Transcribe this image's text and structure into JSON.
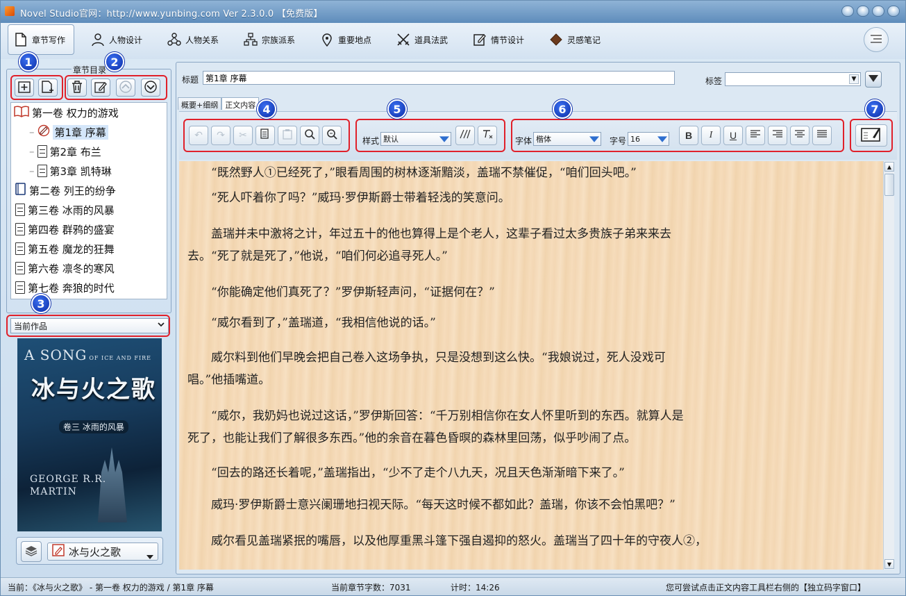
{
  "window": {
    "title": "Novel Studio官网：http://www.yunbing.com Ver 2.3.0.0 【免费版】"
  },
  "nav": [
    {
      "label": "章节写作",
      "icon": "chapter-page-icon",
      "active": true
    },
    {
      "label": "人物设计",
      "icon": "person-icon"
    },
    {
      "label": "人物关系",
      "icon": "relation-icon"
    },
    {
      "label": "宗族派系",
      "icon": "hierarchy-icon"
    },
    {
      "label": "重要地点",
      "icon": "location-pin-icon"
    },
    {
      "label": "道具法武",
      "icon": "swords-icon"
    },
    {
      "label": "情节设计",
      "icon": "edit-square-icon"
    },
    {
      "label": "灵感笔记",
      "icon": "notebook-icon"
    }
  ],
  "left": {
    "tree_title": "章节目录",
    "tree": [
      {
        "label": "第一卷 权力的游戏",
        "kind": "volume-open"
      },
      {
        "label": "第1章 序幕",
        "kind": "chapter-active",
        "selected": true
      },
      {
        "label": "第2章 布兰",
        "kind": "chapter"
      },
      {
        "label": "第3章 凯特琳",
        "kind": "chapter"
      },
      {
        "label": "第二卷 列王的纷争",
        "kind": "volume"
      },
      {
        "label": "第三卷 冰雨的风暴",
        "kind": "volume"
      },
      {
        "label": "第四卷 群鸦的盛宴",
        "kind": "volume"
      },
      {
        "label": "第五卷 魔龙的狂舞",
        "kind": "volume"
      },
      {
        "label": "第六卷 凛冬的寒风",
        "kind": "volume"
      },
      {
        "label": "第七卷 奔狼的时代",
        "kind": "volume"
      }
    ],
    "current_work": "当前作品",
    "cover": {
      "title_en_1": "A SONG",
      "title_en_2": "OF ICE AND FIRE",
      "title_zh": "冰与火之歌",
      "volume": "卷三 冰雨的风暴",
      "author_1": "GEORGE R.R.",
      "author_2": "MARTIN"
    },
    "book_name": "冰与火之歌"
  },
  "callouts": [
    "1",
    "2",
    "3",
    "4",
    "5",
    "6",
    "7"
  ],
  "editor": {
    "title_label": "标题",
    "title_value": "第1章 序幕",
    "tag_label": "标签",
    "tag_value": "",
    "tabs": [
      "概要+细纲",
      "正文内容"
    ],
    "style_label": "样式",
    "style_value": "默认",
    "font_label": "字体",
    "font_value": "楷体",
    "size_label": "字号",
    "size_value": "16",
    "format_buttons": [
      "B",
      "I",
      "U"
    ]
  },
  "text_lines": [
    "　　“既然野人①已经死了，”眼看周围的树林逐渐黯淡，盖瑞不禁催促，“咱们回头吧。”",
    "　　“死人吓着你了吗？”威玛·罗伊斯爵士带着轻浅的笑意问。",
    "　　盖瑞并未中激将之计，年过五十的他也算得上是个老人，这辈子看过太多贵族子弟来来去",
    "去。“死了就是死了，”他说，“咱们何必追寻死人。”",
    "　　“你能确定他们真死了？”罗伊斯轻声问，“证据何在？”",
    "　　“威尔看到了，”盖瑞道，“我相信他说的话。”",
    "　　威尔料到他们早晚会把自己卷入这场争执，只是没想到这么快。“我娘说过，死人没戏可",
    "唱。”他插嘴道。",
    "　　“威尔，我奶妈也说过这话，”罗伊斯回答：“千万别相信你在女人怀里听到的东西。就算人是",
    "死了，也能让我们了解很多东西。”他的余音在暮色昏暝的森林里回荡，似乎吵闹了点。",
    "　　“回去的路还长着呢，”盖瑞指出，“少不了走个八九天，况且天色渐渐暗下来了。”",
    "　　威玛·罗伊斯爵士意兴阑珊地扫视天际。“每天这时候不都如此？盖瑞，你该不会怕黑吧？”",
    "　　威尔看见盖瑞紧抿的嘴唇，以及他厚重黑斗篷下强自遏抑的怒火。盖瑞当了四十年的守夜人②，"
  ],
  "status": {
    "current": "当前：《冰与火之歌》 - 第一卷 权力的游戏 / 第1章 序幕",
    "word_count": "当前章节字数：7031",
    "timer": "计时：14:26",
    "hint": "您可尝试点击正文内容工具栏右侧的【独立码字窗口】"
  },
  "colors": {
    "accent": "#1f4fd8",
    "callout_border": "#e0202a",
    "paper": "#f5dbb9"
  }
}
